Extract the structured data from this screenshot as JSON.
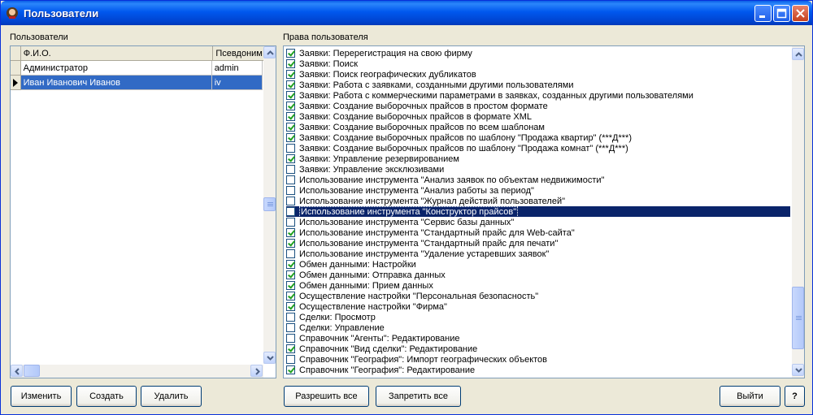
{
  "window": {
    "title": "Пользователи",
    "icon": "app-icon"
  },
  "users_panel": {
    "label": "Пользователи",
    "columns": [
      "Ф.И.О.",
      "Псевдоним"
    ],
    "rows": [
      {
        "name": "Администратор",
        "alias": "admin",
        "selected": false
      },
      {
        "name": "Иван Иванович Иванов",
        "alias": "iv",
        "selected": true
      }
    ]
  },
  "rights_panel": {
    "label": "Права пользователя",
    "items": [
      {
        "text": "Заявки: Перерегистрация на свою фирму",
        "checked": true
      },
      {
        "text": "Заявки: Поиск",
        "checked": true
      },
      {
        "text": "Заявки: Поиск географических дубликатов",
        "checked": true
      },
      {
        "text": "Заявки: Работа с заявками, созданными другими пользователями",
        "checked": true
      },
      {
        "text": "Заявки: Работа с коммерческими параметрами в заявках, созданных другими пользователями",
        "checked": true
      },
      {
        "text": "Заявки: Создание выборочных прайсов в простом формате",
        "checked": true
      },
      {
        "text": "Заявки: Создание выборочных прайсов в формате XML",
        "checked": true
      },
      {
        "text": "Заявки: Создание выборочных прайсов по всем шаблонам",
        "checked": true
      },
      {
        "text": "Заявки: Создание выборочных прайсов по шаблону \"Продажа квартир\" (***Д***)",
        "checked": true
      },
      {
        "text": "Заявки: Создание выборочных прайсов по шаблону \"Продажа комнат\" (***Д***)",
        "checked": false
      },
      {
        "text": "Заявки: Управление резервированием",
        "checked": true
      },
      {
        "text": "Заявки: Управление эксклюзивами",
        "checked": false
      },
      {
        "text": "Использование инструмента \"Анализ заявок по объектам недвижимости\"",
        "checked": false
      },
      {
        "text": "Использование инструмента \"Анализ работы за период\"",
        "checked": false
      },
      {
        "text": "Использование инструмента \"Журнал действий пользователей\"",
        "checked": false
      },
      {
        "text": "Использование инструмента \"Конструктор прайсов\"",
        "checked": false,
        "selected": true
      },
      {
        "text": "Использование инструмента \"Сервис базы данных\"",
        "checked": false
      },
      {
        "text": "Использование инструмента \"Стандартный прайс для Web-сайта\"",
        "checked": true
      },
      {
        "text": "Использование инструмента \"Стандартный прайс для печати\"",
        "checked": true
      },
      {
        "text": "Использование инструмента \"Удаление устаревших заявок\"",
        "checked": false
      },
      {
        "text": "Обмен данными: Настройки",
        "checked": true
      },
      {
        "text": "Обмен данными: Отправка данных",
        "checked": true
      },
      {
        "text": "Обмен данными: Прием данных",
        "checked": true
      },
      {
        "text": "Осуществление настройки \"Персональная безопасность\"",
        "checked": true
      },
      {
        "text": "Осуществление настройки \"Фирма\"",
        "checked": true
      },
      {
        "text": "Сделки: Просмотр",
        "checked": false
      },
      {
        "text": "Сделки: Управление",
        "checked": false
      },
      {
        "text": "Справочник \"Агенты\": Редактирование",
        "checked": false
      },
      {
        "text": "Справочник \"Вид сделки\": Редактирование",
        "checked": true
      },
      {
        "text": "Справочник \"География\": Импорт географических объектов",
        "checked": false
      },
      {
        "text": "Справочник \"География\": Редактирование",
        "checked": true
      }
    ]
  },
  "buttons": {
    "edit": "Изменить",
    "create": "Создать",
    "delete": "Удалить",
    "allow_all": "Разрешить все",
    "deny_all": "Запретить все",
    "exit": "Выйти",
    "help": "?"
  }
}
